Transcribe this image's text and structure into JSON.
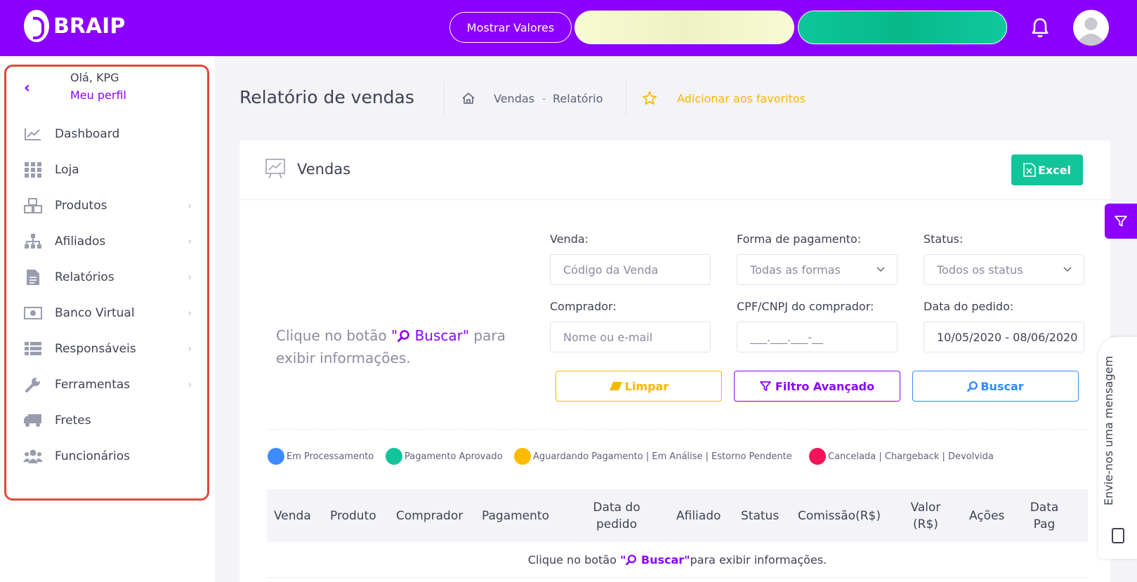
{
  "brand": {
    "name": "BRAIP",
    "primary_color": "#8b00ff"
  },
  "topbar": {
    "show_values_label": "Mostrar Valores",
    "bell_icon": "bell-icon",
    "avatar_icon": "user-avatar-icon"
  },
  "sidebar": {
    "greeting": "Olá, KPG",
    "profile_link": "Meu perfil",
    "items": [
      {
        "label": "Dashboard",
        "icon": "chart-line-icon",
        "has_submenu": false
      },
      {
        "label": "Loja",
        "icon": "grid-icon",
        "has_submenu": false
      },
      {
        "label": "Produtos",
        "icon": "boxes-icon",
        "has_submenu": true
      },
      {
        "label": "Afiliados",
        "icon": "sitemap-icon",
        "has_submenu": true
      },
      {
        "label": "Relatórios",
        "icon": "file-icon",
        "has_submenu": true
      },
      {
        "label": "Banco Virtual",
        "icon": "money-icon",
        "has_submenu": true
      },
      {
        "label": "Responsáveis",
        "icon": "list-icon",
        "has_submenu": true
      },
      {
        "label": "Ferramentas",
        "icon": "wrench-icon",
        "has_submenu": true
      },
      {
        "label": "Fretes",
        "icon": "truck-icon",
        "has_submenu": false
      },
      {
        "label": "Funcionários",
        "icon": "users-icon",
        "has_submenu": false
      }
    ]
  },
  "header": {
    "title": "Relatório de vendas",
    "breadcrumb": [
      "Vendas",
      "-",
      "Relatório"
    ],
    "favorite_label": "Adicionar aos favoritos"
  },
  "card": {
    "title": "Vendas",
    "excel_label": "Excel",
    "hint_prefix": "Clique no botão ",
    "hint_button": "\"Buscar\"",
    "hint_suffix": " para exibir informações."
  },
  "filters": {
    "venda": {
      "label": "Venda:",
      "placeholder": "Código da Venda"
    },
    "forma_pagamento": {
      "label": "Forma de pagamento:",
      "value": "Todas as formas"
    },
    "status": {
      "label": "Status:",
      "value": "Todos os status"
    },
    "comprador": {
      "label": "Comprador:",
      "placeholder": "Nome ou e-mail"
    },
    "cpf": {
      "label": "CPF/CNPJ do comprador:",
      "placeholder": "___.___.___-__"
    },
    "data_pedido": {
      "label": "Data do pedido:",
      "value": "10/05/2020 - 08/06/2020"
    }
  },
  "actions": {
    "limpar": "Limpar",
    "filtro_avancado": "Filtro Avançado",
    "buscar": "Buscar"
  },
  "legend": [
    {
      "label": "Em Processamento",
      "color": "#3d8bff"
    },
    {
      "label": "Pagamento Aprovado",
      "color": "#12c49a"
    },
    {
      "label": "Aguardando Pagamento | Em Análise | Estorno Pendente",
      "color": "#ffbb00"
    },
    {
      "label": "Cancelada | Chargeback | Devolvida",
      "color": "#f5145a"
    }
  ],
  "table": {
    "headers": [
      "Venda",
      "Produto",
      "Comprador",
      "Pagamento",
      "Data do pedido",
      "Afiliado",
      "Status",
      "Comissão(R$)",
      "Valor (R$)",
      "Ações",
      "Data Pag"
    ],
    "empty_prefix": "Clique no botão ",
    "empty_button": "\"Buscar\"",
    "empty_suffix": " para exibir informações."
  },
  "floating": {
    "message_label": "Envie-nos uma mensagem"
  }
}
